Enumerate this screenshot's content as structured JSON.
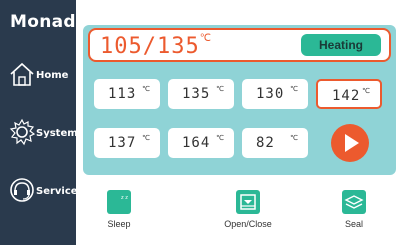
{
  "app": {
    "brand": "Monad"
  },
  "sidebar": {
    "items": [
      {
        "label": "Home",
        "icon": "home-icon"
      },
      {
        "label": "System",
        "icon": "gear-icon"
      },
      {
        "label": "Service",
        "icon": "headset-icon"
      }
    ]
  },
  "header": {
    "current_temp": "105",
    "target_temp": "135",
    "unit": "℃",
    "status": "Heating"
  },
  "presets": [
    {
      "value": "113",
      "unit": "℃",
      "selected": false
    },
    {
      "value": "135",
      "unit": "℃",
      "selected": false
    },
    {
      "value": "130",
      "unit": "℃",
      "selected": false
    },
    {
      "value": "142",
      "unit": "℃",
      "selected": true
    },
    {
      "value": "137",
      "unit": "℃",
      "selected": false
    },
    {
      "value": "164",
      "unit": "℃",
      "selected": false
    },
    {
      "value": "82",
      "unit": "℃",
      "selected": false
    }
  ],
  "actions": {
    "start_icon": "play-icon",
    "sleep": "Sleep",
    "open_close": "Open/Close",
    "seal": "Seal"
  },
  "colors": {
    "accent": "#ec5a2e",
    "teal": "#8fd3d6",
    "status_green": "#2bb896",
    "sidebar": "#2a3a4d",
    "icon_green": "#2bb896"
  }
}
